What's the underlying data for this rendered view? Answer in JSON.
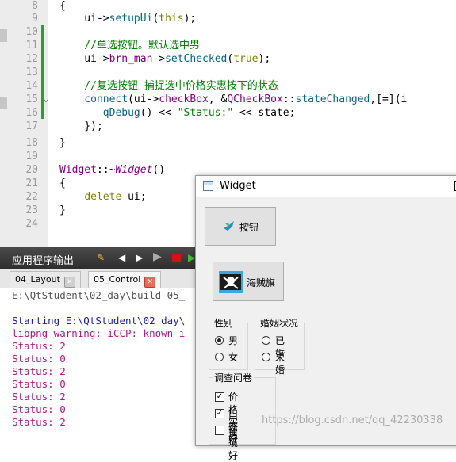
{
  "code_lines": [
    {
      "num": "8",
      "text": "{"
    },
    {
      "num": "9",
      "text": "    ui->setupUi(this);"
    },
    {
      "num": "10",
      "text": ""
    },
    {
      "num": "11",
      "text": "    //单选按钮。默认选中男"
    },
    {
      "num": "12",
      "text": "    ui->brn_man->setChecked(true);"
    },
    {
      "num": "13",
      "text": ""
    },
    {
      "num": "14",
      "text": "    //复选按钮 捕捉选中价格实惠按下的状态"
    },
    {
      "num": "15",
      "text": "    connect(ui->checkBox, &QCheckBox::stateChanged,[=](i"
    },
    {
      "num": "16",
      "text": "       qDebug() << \"Status:\" << state;"
    },
    {
      "num": "17",
      "text": "    });"
    },
    {
      "num": "18",
      "text": "}"
    },
    {
      "num": "19",
      "text": ""
    },
    {
      "num": "20",
      "text": "Widget::~Widget()"
    },
    {
      "num": "21",
      "text": "{"
    },
    {
      "num": "22",
      "text": "    delete ui;"
    },
    {
      "num": "23",
      "text": "}"
    },
    {
      "num": "24",
      "text": ""
    }
  ],
  "output_pane": {
    "title": "应用程序输出",
    "tabs": [
      {
        "label": "04_Layout"
      },
      {
        "label": "05_Control"
      }
    ],
    "lines": [
      {
        "text": "E:\\QtStudent\\02_day\\build-05_",
        "color": "#555555"
      },
      {
        "text": "",
        "color": "#000000"
      },
      {
        "text": "Starting E:\\QtStudent\\02_day\\",
        "color": "#1a1aa6"
      },
      {
        "text": "libpng warning: iCCP: known i",
        "color": "#b0177f"
      },
      {
        "text": "Status: 2",
        "color": "#b0177f"
      },
      {
        "text": "Status: 0",
        "color": "#b0177f"
      },
      {
        "text": "Status: 2",
        "color": "#b0177f"
      },
      {
        "text": "Status: 0",
        "color": "#b0177f"
      },
      {
        "text": "Status: 2",
        "color": "#b0177f"
      },
      {
        "text": "Status: 0",
        "color": "#b0177f"
      },
      {
        "text": "Status: 2",
        "color": "#b0177f"
      }
    ]
  },
  "widget_window": {
    "title": "Widget",
    "minimize_glyph": "—",
    "button1": {
      "label": "按钮",
      "icon": "bird-icon"
    },
    "button2": {
      "label": "海贼旗",
      "icon": "jolly-roger-icon"
    },
    "gender": {
      "title": "性别",
      "options": [
        {
          "label": "男",
          "checked": true
        },
        {
          "label": "女",
          "checked": false
        }
      ]
    },
    "marital": {
      "title": "婚姻状况",
      "options": [
        {
          "label": "已婚",
          "checked": false
        },
        {
          "label": "未婚",
          "checked": false
        }
      ]
    },
    "survey": {
      "title": "调查问卷",
      "options": [
        {
          "label": "价格实惠",
          "checked": true
        },
        {
          "label": "口感好",
          "checked": true
        },
        {
          "label": "环境好",
          "checked": false
        }
      ]
    }
  },
  "watermark": "https://blog.csdn.net/qq_42230338"
}
